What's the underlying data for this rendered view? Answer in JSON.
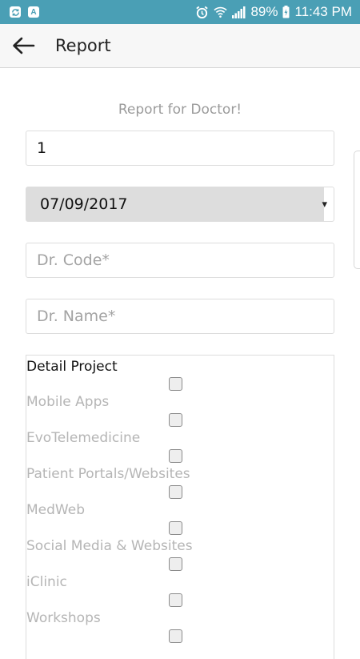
{
  "status_bar": {
    "battery": "89%",
    "time": "11:43 PM",
    "notifications": [
      "sync-icon",
      "a-badge-icon"
    ]
  },
  "app_bar": {
    "title": "Report"
  },
  "form": {
    "heading": "Report for Doctor!",
    "number_value": "1",
    "date_value": "07/09/2017",
    "date_caret": "▾",
    "dr_code_placeholder": "Dr. Code*",
    "dr_name_placeholder": "Dr. Name*"
  },
  "detail_project": {
    "title": "Detail Project",
    "options": [
      "Mobile Apps",
      "EvoTelemedicine",
      "Patient Portals/Websites",
      "MedWeb",
      "Social Media & Websites",
      "iClinic",
      "Workshops"
    ]
  },
  "colors": {
    "status_bar": "#4a9fb5",
    "app_bar": "#f7f7f7",
    "placeholder": "#a3a3a3",
    "option_text": "#b5b5b5"
  }
}
